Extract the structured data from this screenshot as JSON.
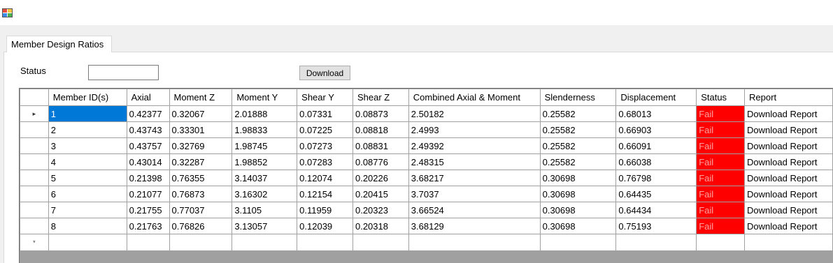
{
  "window": {
    "icon": "app-icon"
  },
  "tabs": [
    {
      "label": "Member Design Ratios"
    }
  ],
  "form": {
    "status_label": "Status",
    "status_value": "",
    "download_label": "Download"
  },
  "grid": {
    "columns": [
      "Member ID(s)",
      "Axial",
      "Moment Z",
      "Moment Y",
      "Shear Y",
      "Shear Z",
      "Combined Axial & Moment",
      "Slenderness",
      "Displacement",
      "Status",
      "Report"
    ],
    "current_row_indicator": "▸",
    "new_row_indicator": "*",
    "rows": [
      {
        "cells": [
          "1",
          "0.42377",
          "0.32067",
          "2.01888",
          "0.07331",
          "0.08873",
          "2.50182",
          "0.25582",
          "0.68013",
          "Fail",
          "Download Report"
        ]
      },
      {
        "cells": [
          "2",
          "0.43743",
          "0.33301",
          "1.98833",
          "0.07225",
          "0.08818",
          "2.4993",
          "0.25582",
          "0.66903",
          "Fail",
          "Download Report"
        ]
      },
      {
        "cells": [
          "3",
          "0.43757",
          "0.32769",
          "1.98745",
          "0.07273",
          "0.08831",
          "2.49392",
          "0.25582",
          "0.66091",
          "Fail",
          "Download Report"
        ]
      },
      {
        "cells": [
          "4",
          "0.43014",
          "0.32287",
          "1.98852",
          "0.07283",
          "0.08776",
          "2.48315",
          "0.25582",
          "0.66038",
          "Fail",
          "Download Report"
        ]
      },
      {
        "cells": [
          "5",
          "0.21398",
          "0.76355",
          "3.14037",
          "0.12074",
          "0.20226",
          "3.68217",
          "0.30698",
          "0.76798",
          "Fail",
          "Download Report"
        ]
      },
      {
        "cells": [
          "6",
          "0.21077",
          "0.76873",
          "3.16302",
          "0.12154",
          "0.20415",
          "3.7037",
          "0.30698",
          "0.64435",
          "Fail",
          "Download Report"
        ]
      },
      {
        "cells": [
          "7",
          "0.21755",
          "0.77037",
          "3.1105",
          "0.11959",
          "0.20323",
          "3.66524",
          "0.30698",
          "0.64434",
          "Fail",
          "Download Report"
        ]
      },
      {
        "cells": [
          "8",
          "0.21763",
          "0.76826",
          "3.13057",
          "0.12039",
          "0.20318",
          "3.68129",
          "0.30698",
          "0.75193",
          "Fail",
          "Download Report"
        ]
      }
    ]
  },
  "colors": {
    "fail_bg": "#ff0000",
    "selection_bg": "#0078d7"
  }
}
